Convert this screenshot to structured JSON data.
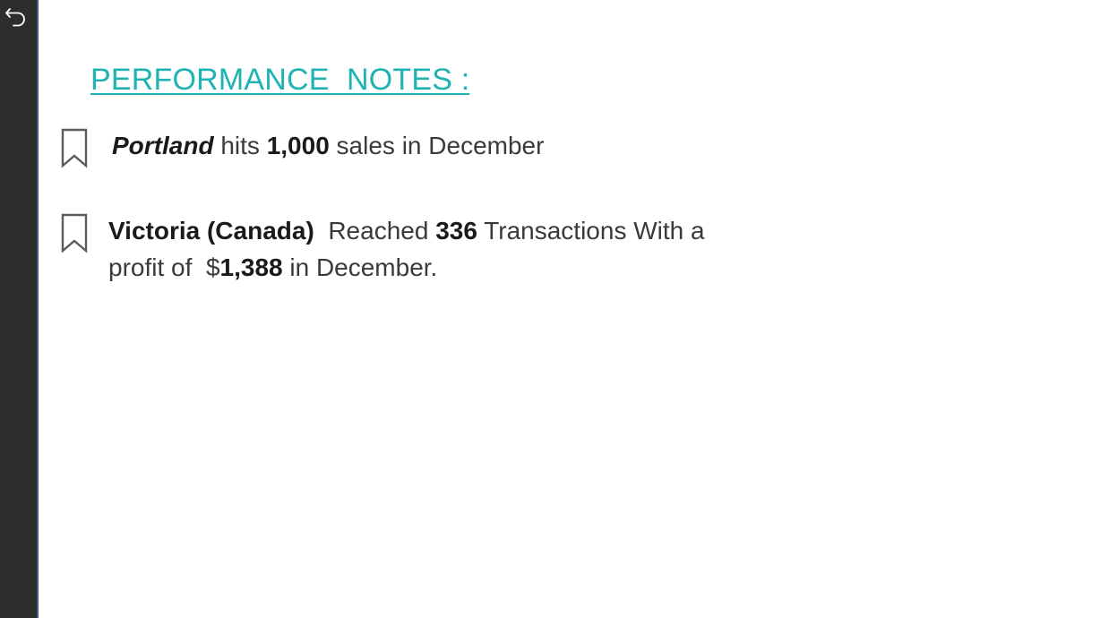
{
  "sidebar": {
    "back_icon": "undo-arrow-icon",
    "background": "#2d2d2d"
  },
  "title": "PERFORMANCE  NOTES :",
  "accent_color": "#1fb3b3",
  "notes": [
    {
      "icon": "bookmark-icon",
      "city": "Portland",
      "text1": " hits ",
      "value": "1,000",
      "text2": " sales in December"
    },
    {
      "icon": "bookmark-icon",
      "city": "Victoria (Canada)",
      "text1": "  Reached ",
      "value": "336",
      "text2": " Transactions With a profit of  $",
      "value2": "1,388",
      "text3": " in December."
    }
  ]
}
